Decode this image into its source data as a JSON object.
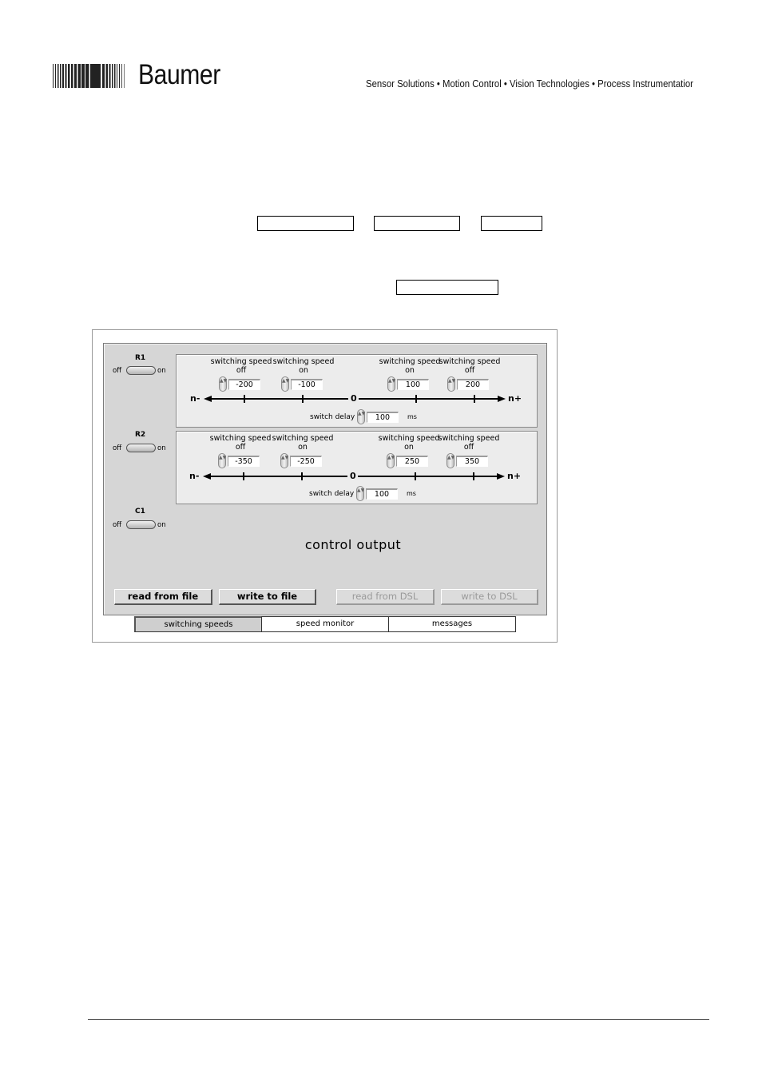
{
  "header": {
    "brand": "Baumer",
    "tagline": "Sensor Solutions • Motion Control • Vision Technologies • Process Instrumentatior"
  },
  "app": {
    "relays": [
      {
        "label": "R1",
        "off_label": "off",
        "on_label": "on",
        "speeds": [
          {
            "caption_line1": "switching speed",
            "caption_line2": "off",
            "value": "-200"
          },
          {
            "caption_line1": "switching speed",
            "caption_line2": "on",
            "value": "-100"
          },
          {
            "caption_line1": "switching speed",
            "caption_line2": "on",
            "value": "100"
          },
          {
            "caption_line1": "switching speed",
            "caption_line2": "off",
            "value": "200"
          }
        ],
        "axis_neg": "n-",
        "axis_zero": "0",
        "axis_pos": "n+",
        "delay_label": "switch delay",
        "delay_value": "100",
        "delay_unit": "ms"
      },
      {
        "label": "R2",
        "off_label": "off",
        "on_label": "on",
        "speeds": [
          {
            "caption_line1": "switching speed",
            "caption_line2": "off",
            "value": "-350"
          },
          {
            "caption_line1": "switching speed",
            "caption_line2": "on",
            "value": "-250"
          },
          {
            "caption_line1": "switching speed",
            "caption_line2": "on",
            "value": "250"
          },
          {
            "caption_line1": "switching speed",
            "caption_line2": "off",
            "value": "350"
          }
        ],
        "axis_neg": "n-",
        "axis_zero": "0",
        "axis_pos": "n+",
        "delay_label": "switch delay",
        "delay_value": "100",
        "delay_unit": "ms"
      }
    ],
    "c1": {
      "label": "C1",
      "off_label": "off",
      "on_label": "on"
    },
    "control_output_label": "control output",
    "buttons": {
      "read_file": "read from file",
      "write_file": "write to file",
      "read_dsl": "read from DSL",
      "write_dsl": "write to DSL"
    },
    "tabs": [
      "switching speeds",
      "speed monitor",
      "messages"
    ],
    "active_tab": "switching speeds"
  }
}
